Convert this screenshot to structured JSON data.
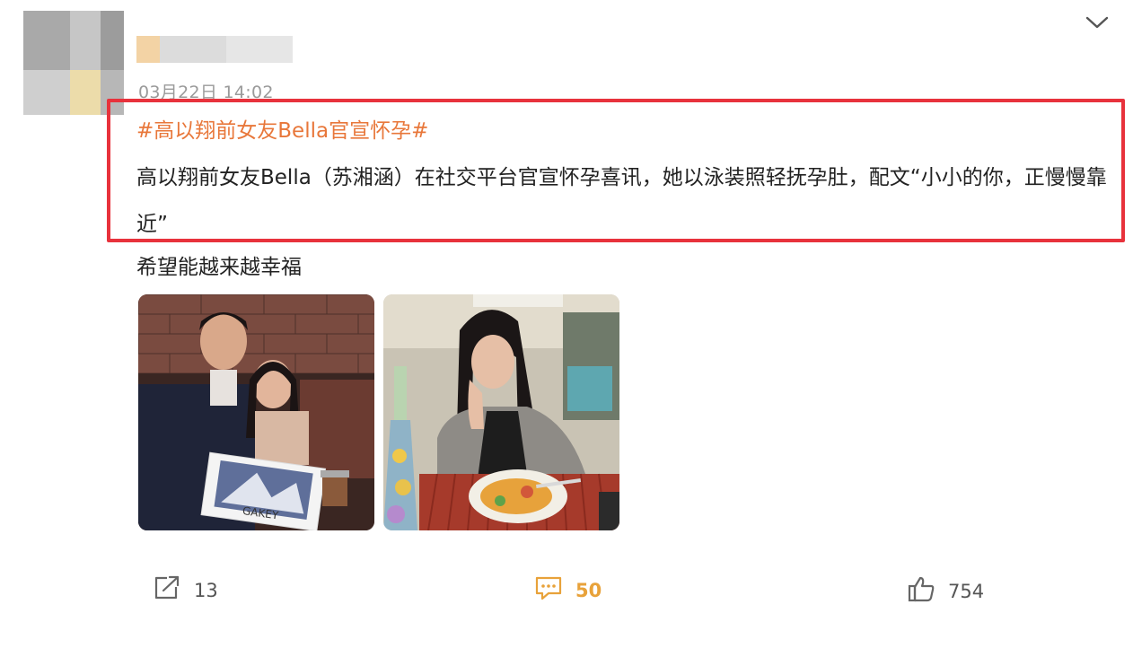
{
  "post": {
    "timestamp": "03月22日 14:02",
    "topic": "#高以翔前女友Bella官宣怀孕#",
    "text": "高以翔前女友Bella（苏湘涵）在社交平台官宣怀孕喜讯，她以泳装照轻抚孕肚，配文“小小的你，正慢慢靠近”",
    "comment": "希望能越来越幸福"
  },
  "photos": [
    {
      "name": "couple-with-cake-photo",
      "cake_text": "GAKEY"
    },
    {
      "name": "woman-at-table-photo"
    }
  ],
  "actions": {
    "repost_count": "13",
    "comment_count": "50",
    "like_count": "754"
  },
  "icons": {
    "menu": "chevron-down-icon",
    "repost": "share-icon",
    "comment": "comment-icon",
    "like": "thumbs-up-icon"
  },
  "colors": {
    "topic": "#e8773a",
    "highlight_border": "#e8323c",
    "comment_count": "#e8a23a",
    "timestamp": "#9a9a9a"
  }
}
